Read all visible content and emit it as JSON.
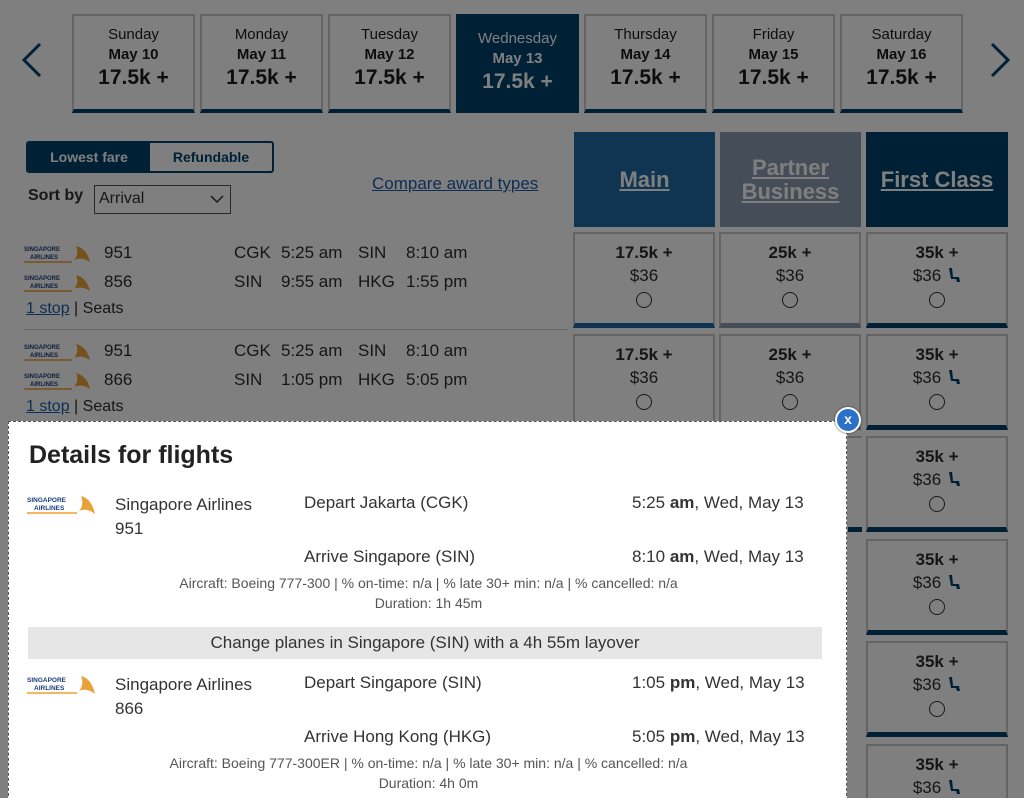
{
  "nav": {
    "prev_label": "",
    "next_label": ""
  },
  "dates": [
    {
      "day": "Sunday",
      "date": "May 10",
      "fare": "17.5k +"
    },
    {
      "day": "Monday",
      "date": "May 11",
      "fare": "17.5k +"
    },
    {
      "day": "Tuesday",
      "date": "May 12",
      "fare": "17.5k +"
    },
    {
      "day": "Wednesday",
      "date": "May 13",
      "fare": "17.5k +"
    },
    {
      "day": "Thursday",
      "date": "May 14",
      "fare": "17.5k +"
    },
    {
      "day": "Friday",
      "date": "May 15",
      "fare": "17.5k +"
    },
    {
      "day": "Saturday",
      "date": "May 16",
      "fare": "17.5k +"
    }
  ],
  "fare_toggle": {
    "lowest": "Lowest fare",
    "refundable": "Refundable"
  },
  "sort": {
    "label": "Sort by",
    "value": "Arrival"
  },
  "compare_link": "Compare award types",
  "cabins": {
    "main": "Main",
    "partner_line1": "Partner",
    "partner_line2": "Business",
    "first": "First Class"
  },
  "flights": [
    {
      "segments": [
        {
          "number": "951",
          "origin": "CGK",
          "depart": "5:25 am",
          "dest": "SIN",
          "arrive": "8:10 am"
        },
        {
          "number": "856",
          "origin": "SIN",
          "depart": "9:55 am",
          "dest": "HKG",
          "arrive": "1:55 pm"
        }
      ],
      "stops": "1 stop",
      "seats": "Seats",
      "fares": {
        "main_miles": "17.5k +",
        "main_tax": "$36",
        "partner_miles": "25k +",
        "partner_tax": "$36",
        "first_miles": "35k +",
        "first_tax": "$36"
      }
    },
    {
      "segments": [
        {
          "number": "951",
          "origin": "CGK",
          "depart": "5:25 am",
          "dest": "SIN",
          "arrive": "8:10 am"
        },
        {
          "number": "866",
          "origin": "SIN",
          "depart": "1:05 pm",
          "dest": "HKG",
          "arrive": "5:05 pm"
        }
      ],
      "stops": "1 stop",
      "seats": "Seats",
      "fares": {
        "main_miles": "17.5k +",
        "main_tax": "$36",
        "partner_miles": "25k +",
        "partner_tax": "$36",
        "first_miles": "35k +",
        "first_tax": "$36"
      }
    }
  ],
  "extra_first_fares": [
    {
      "miles": "35k +",
      "tax": "$36"
    },
    {
      "miles": "35k +",
      "tax": "$36"
    },
    {
      "miles": "35k +",
      "tax": "$36"
    },
    {
      "miles": "35k +",
      "tax": "$36"
    }
  ],
  "modal": {
    "close": "x",
    "title": "Details for flights",
    "segments": [
      {
        "airline": "Singapore Airlines",
        "number": "951",
        "depart_label": "Depart Jakarta (CGK)",
        "depart_time": "5:25",
        "depart_ampm": "am",
        "depart_date": ", Wed, May 13",
        "arrive_label": "Arrive Singapore (SIN)",
        "arrive_time": "8:10",
        "arrive_ampm": "am",
        "arrive_date": ", Wed, May 13",
        "meta": "Aircraft: Boeing 777-300  |  % on-time: n/a  |  % late 30+ min: n/a  |  % cancelled: n/a",
        "duration": "Duration: 1h 45m"
      },
      {
        "airline": "Singapore Airlines",
        "number": "866",
        "depart_label": "Depart Singapore (SIN)",
        "depart_time": "1:05",
        "depart_ampm": "pm",
        "depart_date": ", Wed, May 13",
        "arrive_label": "Arrive Hong Kong (HKG)",
        "arrive_time": "5:05",
        "arrive_ampm": "pm",
        "arrive_date": ", Wed, May 13",
        "meta": "Aircraft: Boeing 777-300ER  |  % on-time: n/a  |  % late 30+ min: n/a  |  % cancelled: n/a",
        "duration": "Duration: 4h 0m"
      }
    ],
    "layover": "Change planes in Singapore (SIN) with a 4h 55m layover"
  },
  "colors": {
    "navy": "#01426a",
    "main": "#1f6aa5",
    "partner": "#8a9bb0",
    "link": "#1b5fa8",
    "close": "#2b70c9"
  },
  "icons": {
    "airline_logo": "singapore-airlines-logo",
    "seat": "seat-icon"
  }
}
